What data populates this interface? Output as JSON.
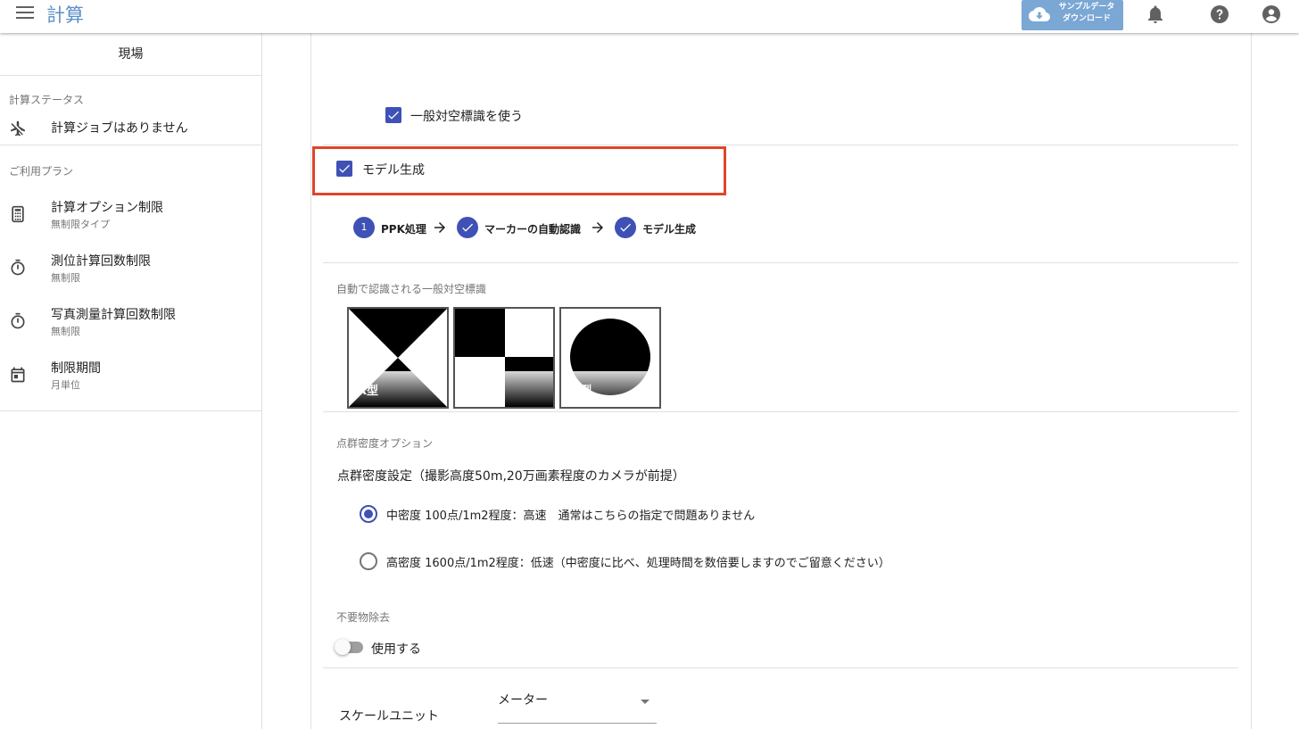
{
  "header": {
    "title": "計算",
    "download_label_line1": "サンプルデータ",
    "download_label_line2": "ダウンロード"
  },
  "sidebar": {
    "site_label": "現場",
    "calc_status_header": "計算ステータス",
    "calc_status_item": "計算ジョブはありません",
    "plan_header": "ご利用プラン",
    "plan_items": [
      {
        "title": "計算オプション制限",
        "sub": "無制限タイプ"
      },
      {
        "title": "測位計算回数制限",
        "sub": "無制限"
      },
      {
        "title": "写真測量計算回数制限",
        "sub": "無制限"
      },
      {
        "title": "制限期間",
        "sub": "月単位"
      }
    ]
  },
  "main": {
    "general_marker_checkbox": {
      "label": "一般対空標識を使う",
      "checked": true
    },
    "model_checkbox": {
      "label": "モデル生成",
      "checked": true
    },
    "steps": [
      {
        "number": "1",
        "label": "PPK処理"
      },
      {
        "label": "マーカーの自動認識"
      },
      {
        "label": "モデル生成"
      }
    ],
    "markers_caption": "自動で認識される一般対空標識",
    "markers": [
      {
        "label": "X型"
      },
      {
        "label": "十型"
      },
      {
        "label": "○型"
      }
    ],
    "density_caption": "点群密度オプション",
    "density_title": "点群密度設定（撮影高度50m,20万画素程度のカメラが前提）",
    "density_options": [
      {
        "label": "中密度 100点/1m2程度：高速　通常はこちらの指定で問題ありません",
        "selected": true
      },
      {
        "label": "高密度 1600点/1m2程度：低速（中密度に比べ、処理時間を数倍要しますのでご留意ください）",
        "selected": false
      }
    ],
    "removal_caption": "不要物除去",
    "removal_toggle": {
      "label": "使用する",
      "on": false
    },
    "scale_unit_label": "スケールユニット",
    "scale_unit_value": "メーター"
  },
  "colors": {
    "accent": "#3f51b5",
    "title_blue": "#5b8fc7",
    "download_bg": "#7aa7d4",
    "highlight_red": "#e0452b"
  }
}
